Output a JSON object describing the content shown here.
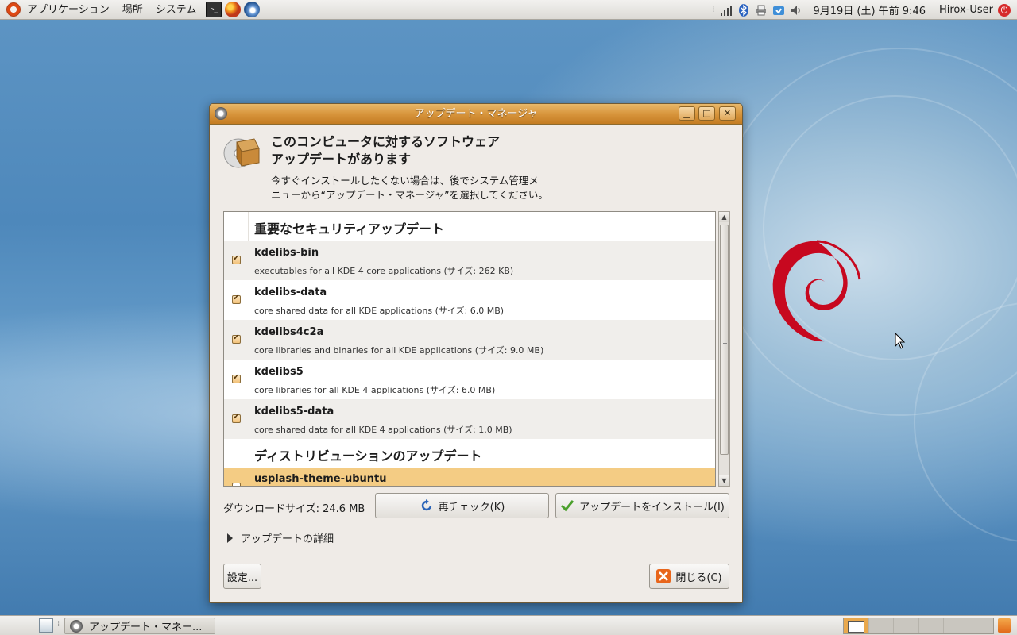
{
  "top_panel": {
    "menus": [
      "アプリケーション",
      "場所",
      "システム"
    ],
    "launchers": [
      "terminal-icon",
      "firefox-icon",
      "thunderbird-icon"
    ],
    "tray_icons": [
      "network-icon",
      "bluetooth-icon",
      "printer-icon",
      "update-notifier-icon",
      "volume-icon"
    ],
    "clock": "9月19日 (土) 午前 9:46",
    "user": "Hirox-User"
  },
  "window": {
    "title": "アップデート・マネージャ",
    "heading_line1": "このコンピュータに対するソフトウェア",
    "heading_line2": "アップデートがあります",
    "subtext_line1": "今すぐインストールしたくない場合は、後でシステム管理メ",
    "subtext_line2": "ニューから“アップデート・マネージャ”を選択してください。",
    "groups": [
      {
        "header": "重要なセキュリティアップデート",
        "packages": [
          {
            "name": "kdelibs-bin",
            "desc": "executables for all KDE 4 core applications (サイズ: 262 KB)",
            "checked": true
          },
          {
            "name": "kdelibs-data",
            "desc": "core shared data for all KDE applications (サイズ: 6.0 MB)",
            "checked": true
          },
          {
            "name": "kdelibs4c2a",
            "desc": "core libraries and binaries for all KDE applications (サイズ: 9.0 MB)",
            "checked": true
          },
          {
            "name": "kdelibs5",
            "desc": "core libraries for all KDE 4 applications (サイズ: 6.0 MB)",
            "checked": true
          },
          {
            "name": "kdelibs5-data",
            "desc": "core shared data for all KDE 4 applications (サイズ: 1.0 MB)",
            "checked": true
          }
        ]
      },
      {
        "header": "ディストリビューションのアップデート",
        "packages": [
          {
            "name": "usplash-theme-ubuntu",
            "desc": "",
            "checked": false
          }
        ]
      }
    ],
    "download_size": "ダウンロードサイズ: 24.6 MB",
    "recheck_label": "再チェック(K)",
    "install_label": "アップデートをインストール(I)",
    "details_label": "アップデートの詳細",
    "settings_label": "設定...",
    "close_label": "閉じる(C)"
  },
  "bottom_panel": {
    "task_label": "アップデート・マネー..."
  }
}
